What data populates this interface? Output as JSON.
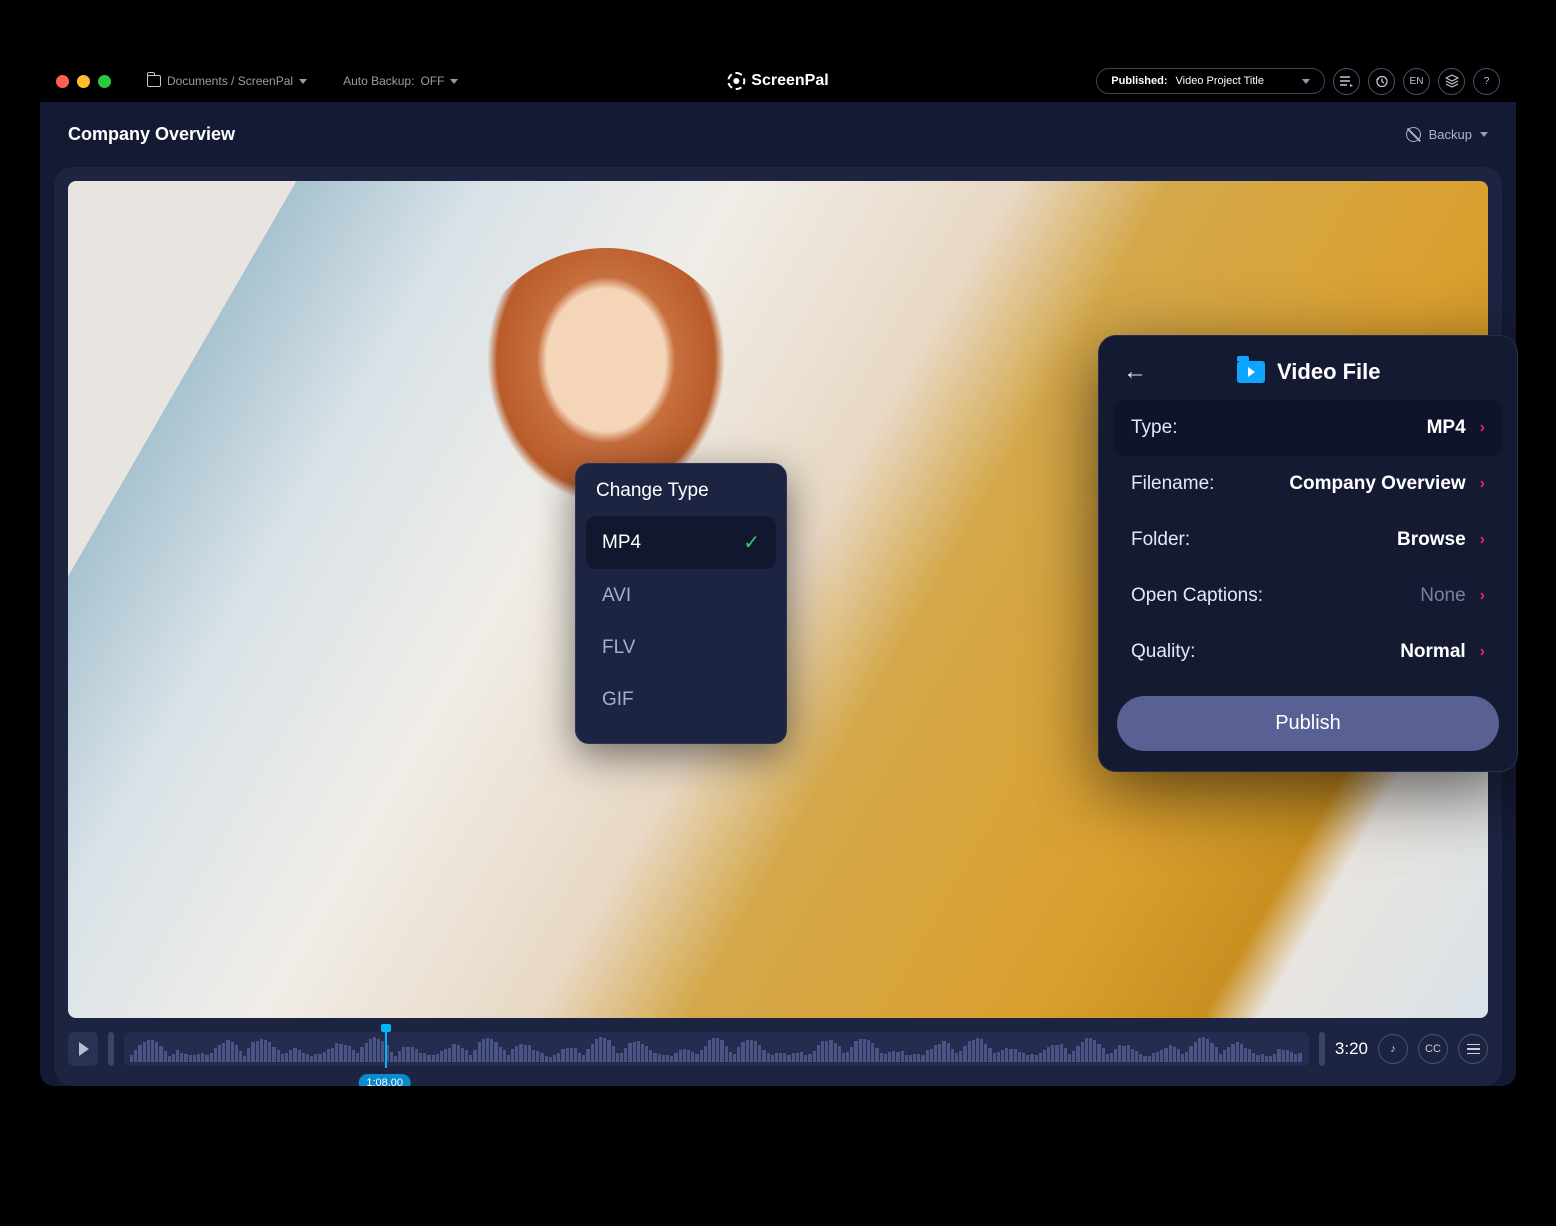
{
  "titlebar": {
    "path": "Documents / ScreenPal",
    "autoBackupLabel": "Auto Backup:",
    "autoBackupValue": "OFF",
    "brand": "ScreenPal",
    "publishedLabel": "Published:",
    "publishedValue": "Video Project Title",
    "langBtn": "EN",
    "helpBtn": "?"
  },
  "subheader": {
    "projectTitle": "Company Overview",
    "backupLabel": "Backup"
  },
  "timeline": {
    "playhead": "1:08.00",
    "duration": "3:20",
    "ccBtn": "CC"
  },
  "changeType": {
    "title": "Change Type",
    "options": [
      "MP4",
      "AVI",
      "FLV",
      "GIF"
    ],
    "selected": "MP4"
  },
  "videoFile": {
    "title": "Video File",
    "rows": {
      "type": {
        "label": "Type:",
        "value": "MP4"
      },
      "filename": {
        "label": "Filename:",
        "value": "Company Overview"
      },
      "folder": {
        "label": "Folder:",
        "value": "Browse"
      },
      "captions": {
        "label": "Open Captions:",
        "value": "None"
      },
      "quality": {
        "label": "Quality:",
        "value": "Normal"
      }
    },
    "publishBtn": "Publish"
  }
}
